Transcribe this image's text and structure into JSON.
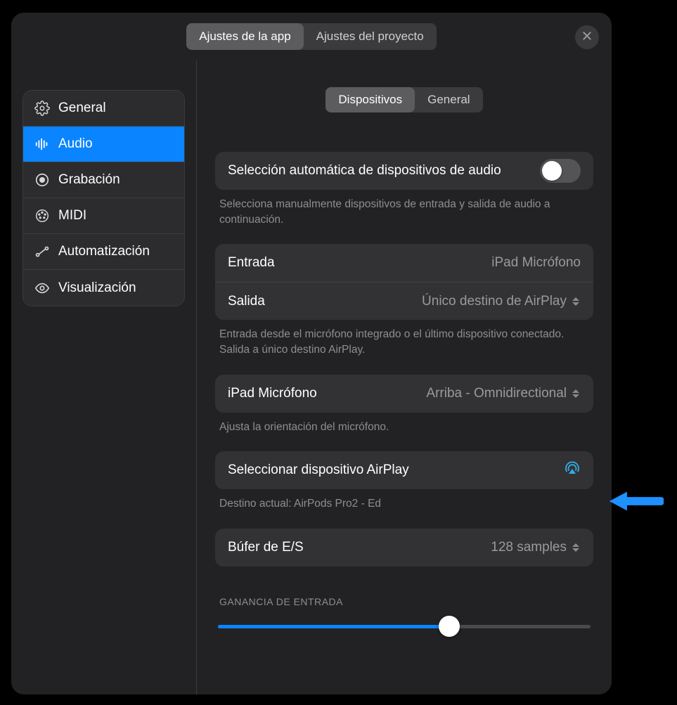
{
  "topSegments": {
    "app": "Ajustes de la app",
    "project": "Ajustes del proyecto"
  },
  "sidebar": {
    "items": [
      {
        "label": "General"
      },
      {
        "label": "Audio"
      },
      {
        "label": "Grabación"
      },
      {
        "label": "MIDI"
      },
      {
        "label": "Automatización"
      },
      {
        "label": "Visualización"
      }
    ]
  },
  "subSegments": {
    "devices": "Dispositivos",
    "general": "General"
  },
  "autoSelect": {
    "label": "Selección automática de dispositivos de audio",
    "desc": "Selecciona manualmente dispositivos de entrada y salida de audio a continuación."
  },
  "io": {
    "inputLabel": "Entrada",
    "inputValue": "iPad Micrófono",
    "outputLabel": "Salida",
    "outputValue": "Único destino de AirPlay",
    "desc": "Entrada desde el micrófono integrado o el último dispositivo conectado. Salida a único destino AirPlay."
  },
  "mic": {
    "label": "iPad Micrófono",
    "value": "Arriba - Omnidirectional",
    "desc": "Ajusta la orientación del micrófono."
  },
  "airplay": {
    "label": "Seleccionar dispositivo AirPlay",
    "desc": "Destino actual: AirPods Pro2 - Ed"
  },
  "buffer": {
    "label": "Búfer de E/S",
    "value": "128 samples"
  },
  "gain": {
    "label": "GANANCIA DE ENTRADA",
    "percent": 62
  }
}
